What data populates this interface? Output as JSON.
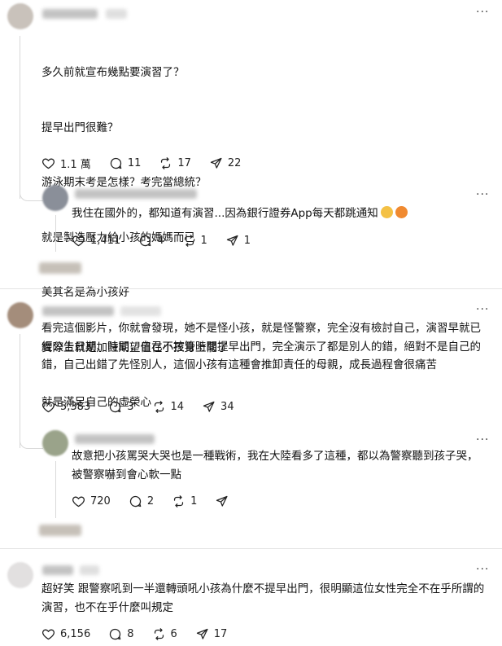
{
  "posts": [
    {
      "id": "post1",
      "lines": [
        "多久前就宣布幾點要演習了？",
        "提早出門很難？",
        "游泳期末考是怎樣？考完當總統？",
        "就是製造壓力給小孩的媽媽而已",
        "美其名是為小孩好",
        "實際上就是加註期望值在小孩身上罷了",
        "就是滿足自己的虛榮心"
      ],
      "likes": "1.1 萬",
      "comments": "11",
      "reposts": "17",
      "shares": "22",
      "reply": {
        "text": "我住在國外的，都知道有演習...因為銀行證券App每天都跳通知",
        "likes": "1,411",
        "comments": "4",
        "reposts": "1",
        "shares": "1"
      }
    },
    {
      "id": "post2",
      "text": "看完這個影片，你就會發現，她不是怪小孩，就是怪警察，完全沒有檢討自己，演習早就已經公告日期、時間，自己不控管時間提早出門，完全演示了都是別人的錯，絕對不是自己的錯，自己出錯了先怪別人，這個小孩有這種會推卸責任的母親，成長過程會很痛苦",
      "likes": "5,383",
      "comments": "3",
      "reposts": "14",
      "shares": "34",
      "reply": {
        "text": "故意把小孩罵哭大哭也是一種戰術，我在大陸看多了這種，都以為警察聽到孩子哭，被警察嚇到會心軟一點",
        "likes": "720",
        "comments": "2",
        "reposts": "1",
        "shares": ""
      }
    },
    {
      "id": "post3",
      "text": "超好笑 跟警察吼到一半還轉頭吼小孩為什麼不提早出門，很明顯這位女性完全不在乎所謂的演習，也不在乎什麼叫規定",
      "likes": "6,156",
      "comments": "8",
      "reposts": "6",
      "shares": "17"
    }
  ],
  "more_label": "···"
}
